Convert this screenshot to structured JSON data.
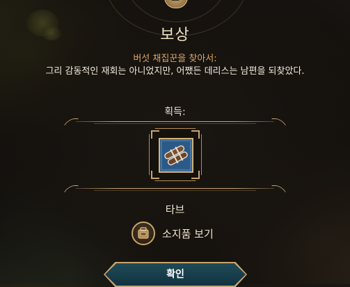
{
  "dialog": {
    "title": "보상",
    "subtitle": "버섯 채집꾼을 찾아서:",
    "description": "그리 감동적인 재회는 아니었지만, 어쨌든 데리스는 남편을 되찾았다."
  },
  "rewards": {
    "label": "획득:",
    "item_name": "타브",
    "item_icon": "scroll-bundle-icon"
  },
  "inventory": {
    "label": "소지품 보기",
    "icon": "backpack-icon"
  },
  "actions": {
    "confirm_label": "확인"
  },
  "colors": {
    "title": "#efe1c6",
    "subtitle": "#d9a866",
    "frame_gold": "#c9a56c",
    "item_bg": "#2b5a88",
    "button_bg": "#1a4250"
  }
}
